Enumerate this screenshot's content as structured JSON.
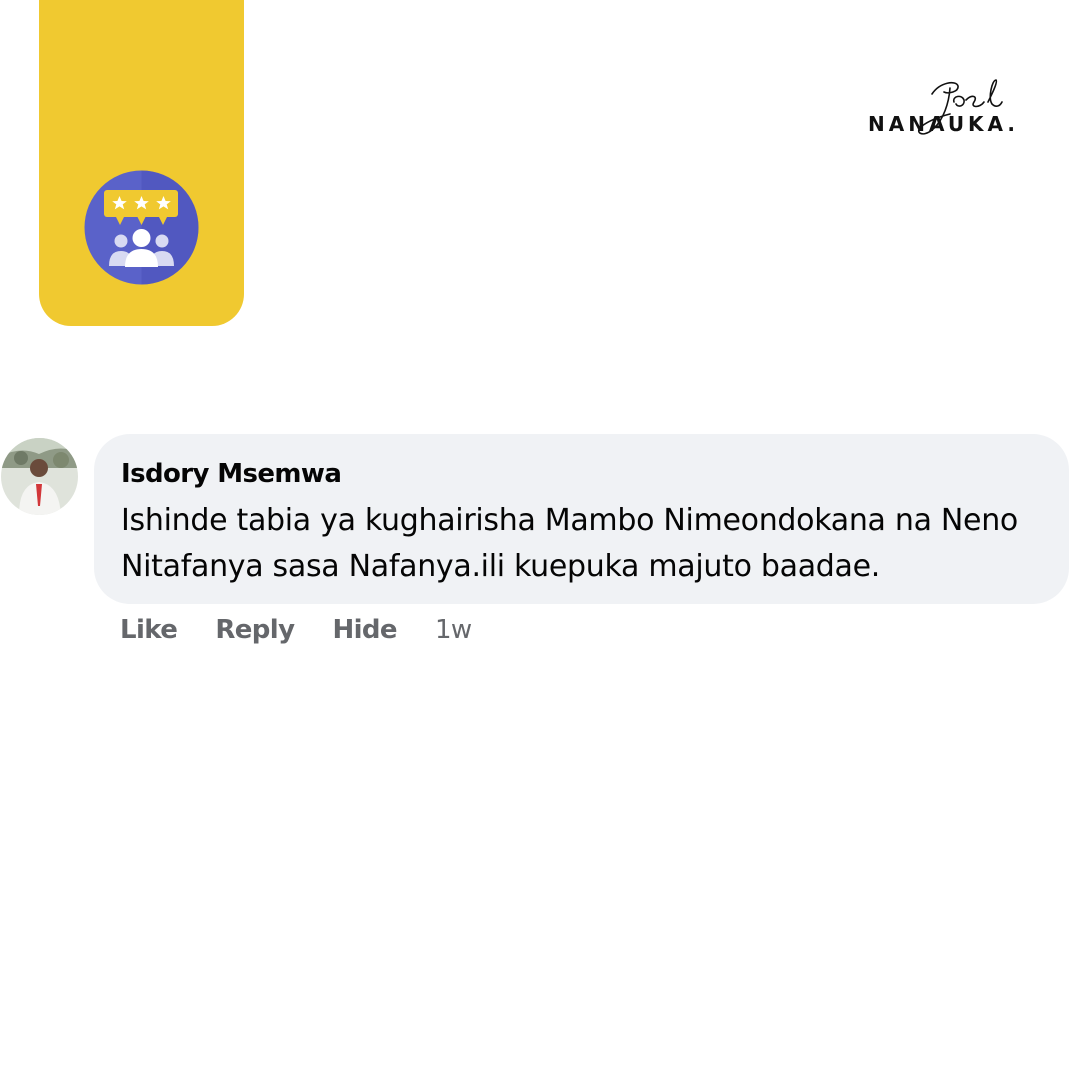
{
  "logo": {
    "signature": "Joel",
    "wordmark": "NANAUKA."
  },
  "badge": {
    "icon": "rating-community-icon",
    "stars": 3
  },
  "comment": {
    "author": "Isdory Msemwa",
    "text": "Ishinde tabia ya kughairisha Mambo Nimeondokana na Neno Nitafanya sasa Nafanya.ili kuepuka majuto baadae.",
    "actions": {
      "like": "Like",
      "reply": "Reply",
      "hide": "Hide",
      "time": "1w"
    }
  },
  "colors": {
    "accent_yellow": "#f0c930",
    "badge_circle": "#5a62c9",
    "bubble_bg": "#f0f2f5",
    "muted_text": "#65676b"
  }
}
